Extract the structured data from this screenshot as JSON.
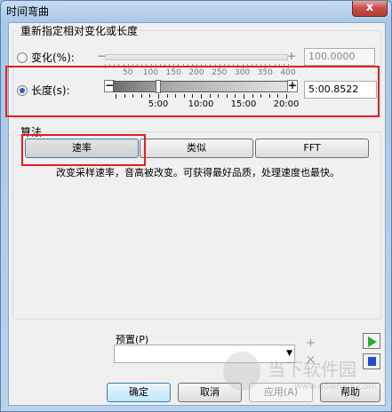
{
  "window": {
    "title": "时间弯曲",
    "close_label": "x"
  },
  "stretch_group": {
    "title": "重新指定相对变化或长度",
    "percent_option": {
      "label": "变化(%):",
      "minus": "−",
      "plus": "+",
      "ticks": [
        "50",
        "100",
        "150",
        "200",
        "250",
        "300",
        "350",
        "400"
      ],
      "value": "100.0000"
    },
    "length_option": {
      "label": "长度(s):",
      "minus": "−",
      "plus": "+",
      "ticks": [
        "5:00",
        "10:00",
        "15:00",
        "20:00"
      ],
      "value": "5:00.8522",
      "thumb_level_percent": 24
    },
    "selected": "length"
  },
  "algorithm_group": {
    "title": "算法",
    "buttons": [
      "速率",
      "类似",
      "FFT"
    ],
    "selected": "速率",
    "description": "改变采样速率，音高被改变。可获得最好品质，处理速度也最快。"
  },
  "preset": {
    "label": "预置(P)",
    "value": ""
  },
  "footer_buttons": {
    "ok": "确定",
    "cancel": "取消",
    "apply": "应用(A)",
    "help": "帮助"
  },
  "watermark": {
    "text": "当下软件园",
    "url": "www.downxia.com"
  },
  "icons": {
    "play": "play-icon",
    "stop": "stop-icon",
    "add": "plus-icon",
    "remove": "close-icon"
  },
  "colors": {
    "highlight": "#e02020",
    "play": "#2faa2f",
    "stop": "#1f4fd0"
  }
}
